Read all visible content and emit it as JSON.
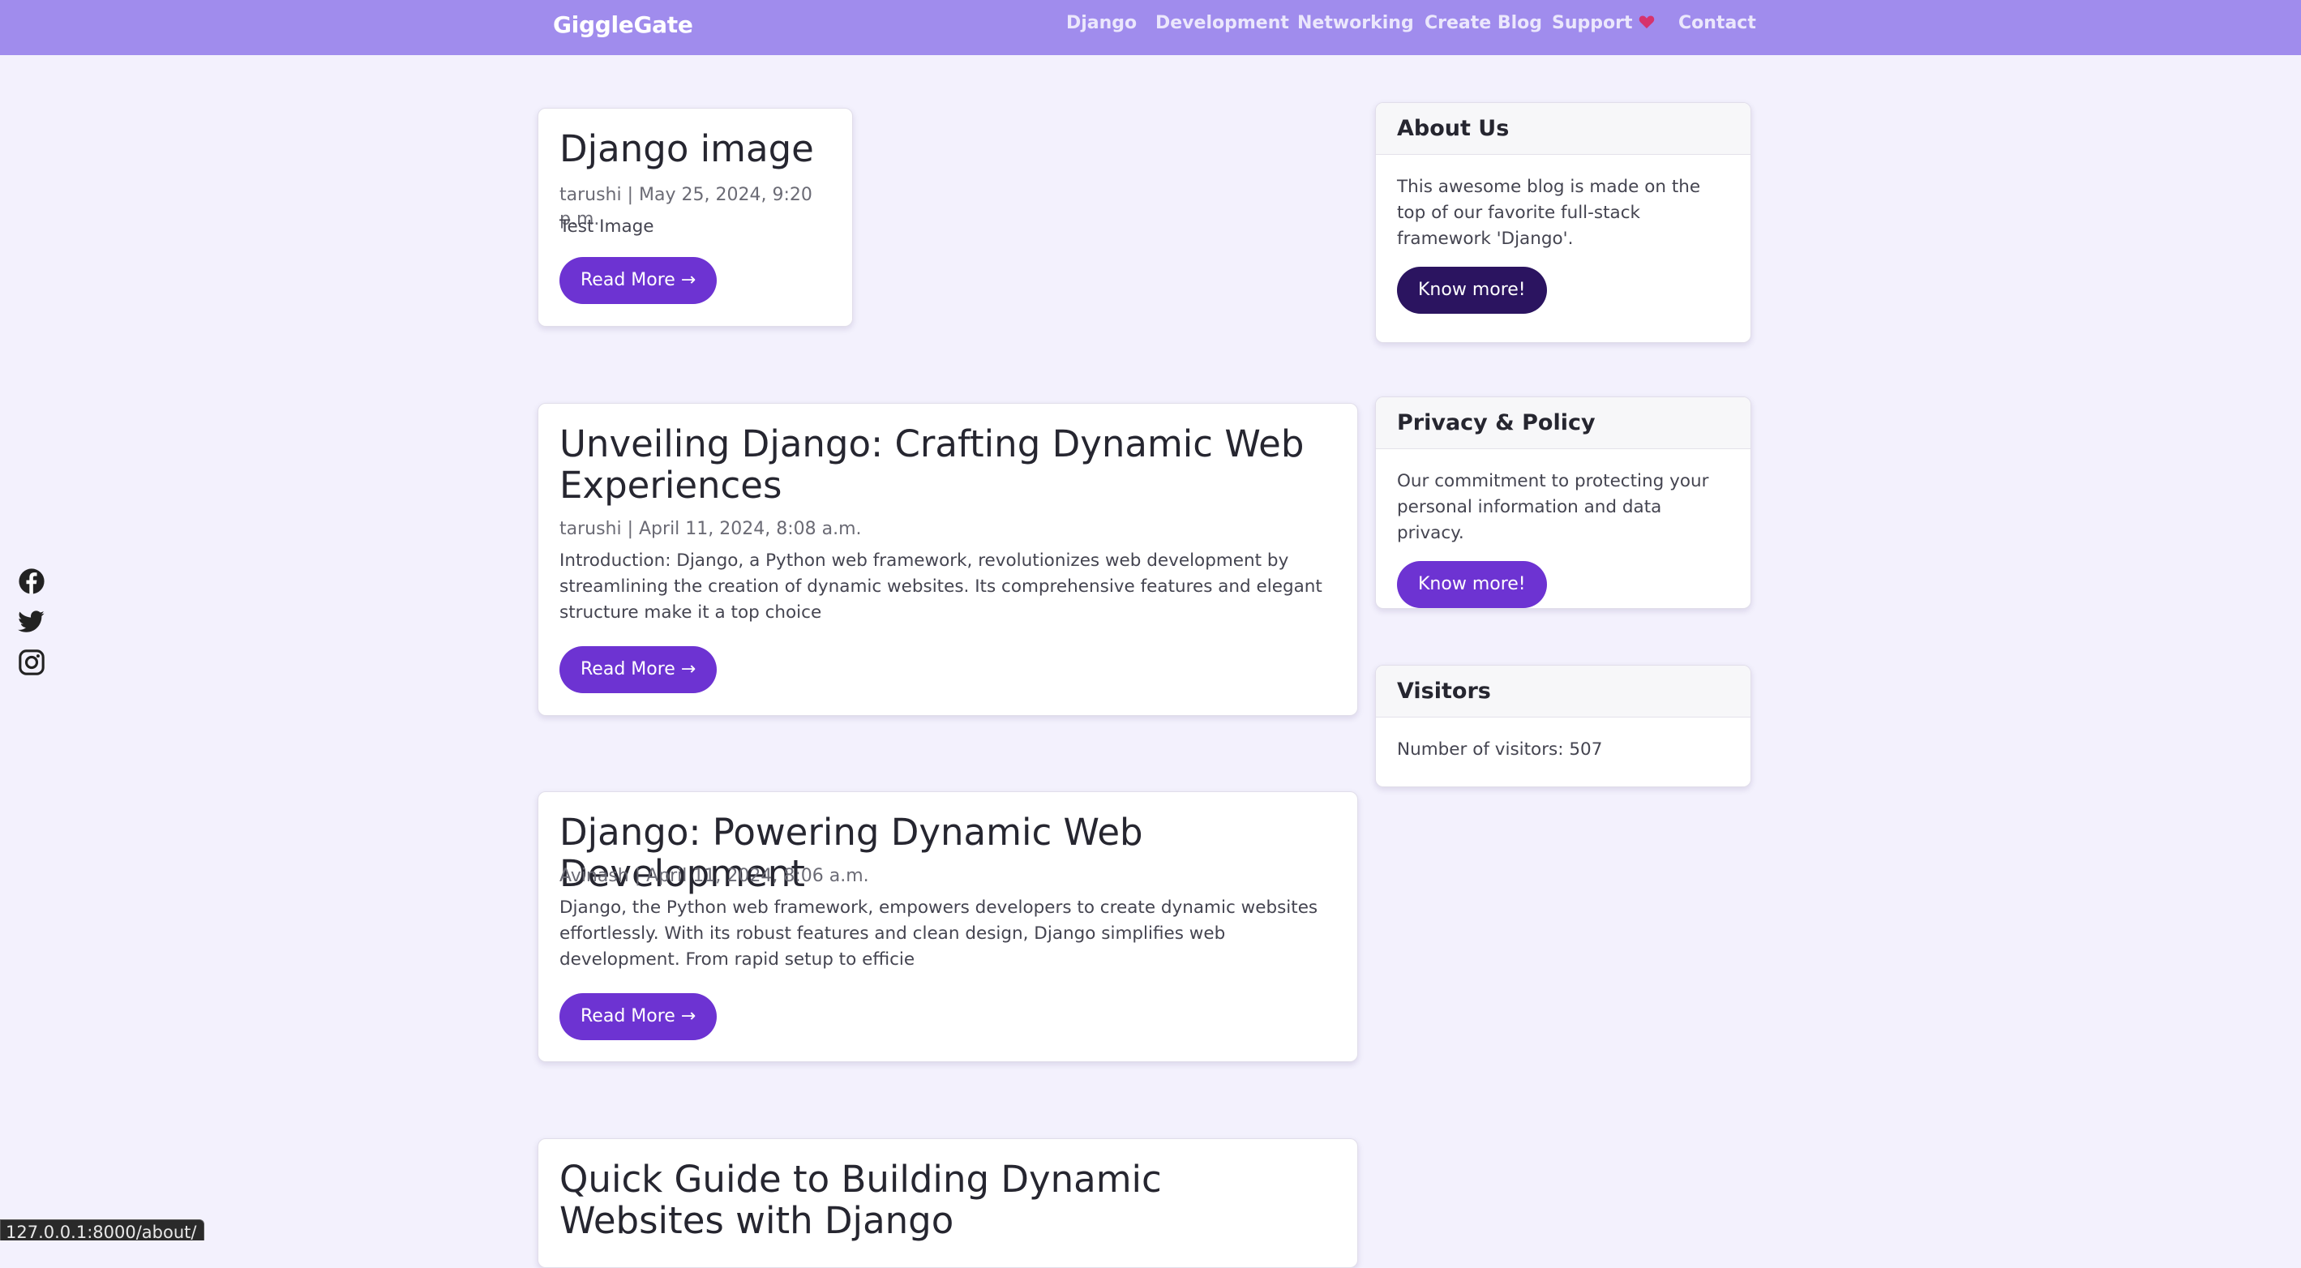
{
  "navbar": {
    "brand": "GiggleGate",
    "links": [
      {
        "label": "Django"
      },
      {
        "label": "Development"
      },
      {
        "label": "Networking"
      },
      {
        "label": "Create Blog"
      },
      {
        "label": "Support",
        "icon": "heart-icon"
      },
      {
        "label": "Contact"
      }
    ],
    "color": "#a08ced"
  },
  "social": [
    "facebook-icon",
    "twitter-icon",
    "instagram-icon"
  ],
  "posts": [
    {
      "title": "Django image",
      "meta": "tarushi | May 25, 2024, 9:20 p.m.",
      "excerpt": "Test Image",
      "button": "Read More →"
    },
    {
      "title": "Unveiling Django: Crafting Dynamic Web Experiences",
      "meta": "tarushi | April 11, 2024, 8:08 a.m.",
      "excerpt": "Introduction: Django, a Python web framework, revolutionizes web development by streamlining the creation of dynamic websites. Its comprehensive features and elegant structure make it a top choice",
      "button": "Read More →"
    },
    {
      "title": "Django: Powering Dynamic Web Development",
      "meta": "Avinash | April 11, 2024, 8:06 a.m.",
      "excerpt": "Django, the Python web framework, empowers developers to create dynamic websites effortlessly. With its robust features and clean design, Django simplifies web development. From rapid setup to efficie",
      "button": "Read More →"
    },
    {
      "title": "Quick Guide to Building Dynamic Websites with Django"
    }
  ],
  "sidebar": {
    "about": {
      "title": "About Us",
      "text": "This awesome blog is made on the top of our favorite full-stack framework 'Django'.",
      "button": "Know more!"
    },
    "privacy": {
      "title": "Privacy & Policy",
      "text": "Our commitment to protecting your personal information and data privacy.",
      "button": "Know more!"
    },
    "visitors": {
      "title": "Visitors",
      "text": "Number of visitors: 507"
    }
  },
  "status_url": "127.0.0.1:8000/about/",
  "colors": {
    "accent": "#6d33d2",
    "accent_dark": "#2b1460",
    "page_bg": "#f3f1fd"
  }
}
